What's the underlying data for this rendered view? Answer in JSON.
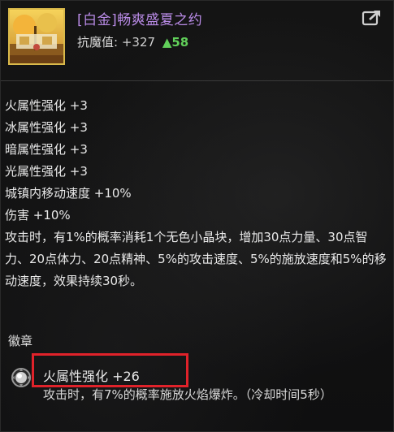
{
  "item": {
    "title": "[白金]畅爽盛夏之约",
    "stat_label": "抗魔值:",
    "stat_value": "+327",
    "stat_delta_icon": "▲",
    "stat_delta": "58"
  },
  "share_icon": "share-arrow-icon",
  "attributes": [
    "火属性强化 +3",
    "冰属性强化 +3",
    "暗属性强化 +3",
    "光属性强化 +3",
    "城镇内移动速度 +10%",
    "伤害 +10%"
  ],
  "effect_text": "攻击时，有1%的概率消耗1个无色小晶块，增加30点力量、30点智力、20点体力、20点精神、5%的攻击速度、5%的施放速度和5%的移动速度，效果持续30秒。",
  "emblem": {
    "header": "徽章",
    "name": "火属性强化 +26",
    "description": "攻击时，有7%的概率施放火焰爆炸。（冷却时间5秒）"
  },
  "colors": {
    "title": "#b98be6",
    "delta": "#61d05a",
    "highlight": "#e0222a",
    "icon_border": "#d9b94a"
  }
}
